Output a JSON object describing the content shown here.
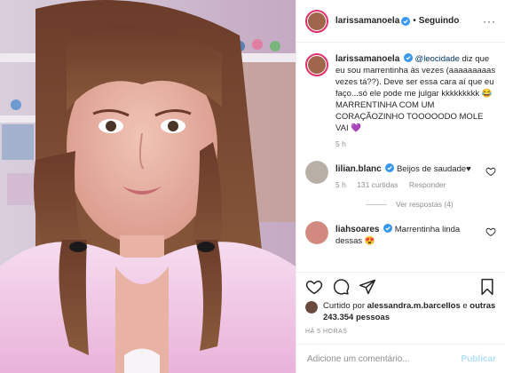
{
  "post": {
    "author": "larissamanoela",
    "follow_dot": "•",
    "follow_status": "Seguindo",
    "more_icon": "more-horizontal-icon"
  },
  "caption": {
    "username": "larissamanoela",
    "mention": "@leocidade",
    "text": " diz que eu sou marrentinha às vezes (aaaaaaaaas vezes tá??). Deve ser essa cara aí que eu faço...só ele pode me julgar kkkkkkkkk 😂 MARRENTINHA COM UM CORAÇÃOZINHO TOOOOODO MOLE VAI 💜",
    "time": "5 h"
  },
  "comments": [
    {
      "username": "lilian.blanc",
      "text": "Beijos de saudade♥",
      "time": "5 h",
      "likes": "131 curtidas",
      "reply": "Responder",
      "view_replies": "Ver respostas (4)"
    },
    {
      "username": "liahsoares",
      "text": "Marrentinha linda dessas 😍"
    }
  ],
  "liked_by": {
    "prefix": "Curtido por ",
    "user": "alessandra.m.barcellos",
    "connector": " e ",
    "others": "outras 243.354 pessoas"
  },
  "timestamp": "HÁ 5 HORAS",
  "add_comment": {
    "placeholder": "Adicione um comentário...",
    "publish": "Publicar"
  },
  "colors": {
    "verified": "#3897f0",
    "ring": "#e1306c",
    "link": "#00376b",
    "muted": "#8e8e8e",
    "publish_disabled": "#b2dffc"
  }
}
